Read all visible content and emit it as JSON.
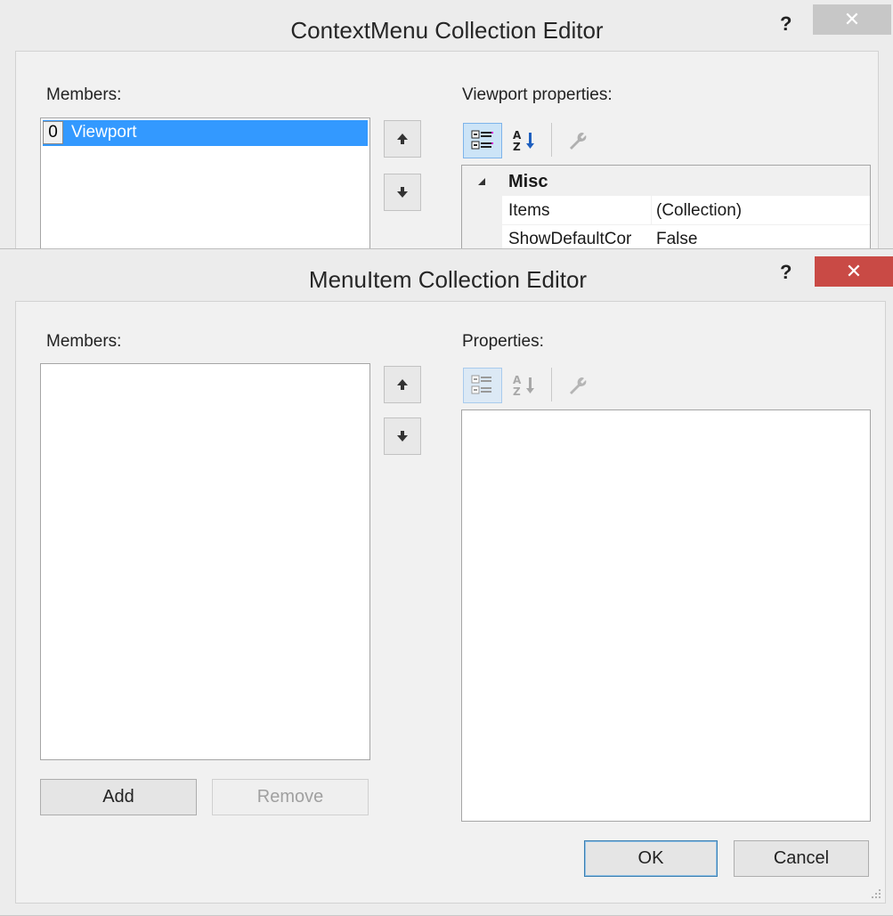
{
  "back_dialog": {
    "title": "ContextMenu Collection Editor",
    "help": "?",
    "close": "✕",
    "members_label": "Members:",
    "members": [
      {
        "index": "0",
        "name": "Viewport"
      }
    ],
    "properties_label": "Viewport properties:",
    "category": "Misc",
    "properties": [
      {
        "name": "Items",
        "value": "(Collection)"
      },
      {
        "name": "ShowDefaultCor",
        "value": "False"
      }
    ]
  },
  "front_dialog": {
    "title": "MenuItem Collection Editor",
    "help": "?",
    "close": "✕",
    "members_label": "Members:",
    "properties_label": "Properties:",
    "add_label": "Add",
    "remove_label": "Remove",
    "ok_label": "OK",
    "cancel_label": "Cancel"
  },
  "icons": {
    "up": "arrow-up-icon",
    "down": "arrow-down-icon",
    "categorized": "categorized-icon",
    "alphabetical": "sort-alphabetical-icon",
    "property_pages": "wrench-icon",
    "collapse": "collapse-triangle-icon",
    "grip": "resize-grip-icon"
  },
  "colors": {
    "selection": "#3399ff",
    "close_active": "#c94a45",
    "close_inactive": "#c7c7c7"
  }
}
